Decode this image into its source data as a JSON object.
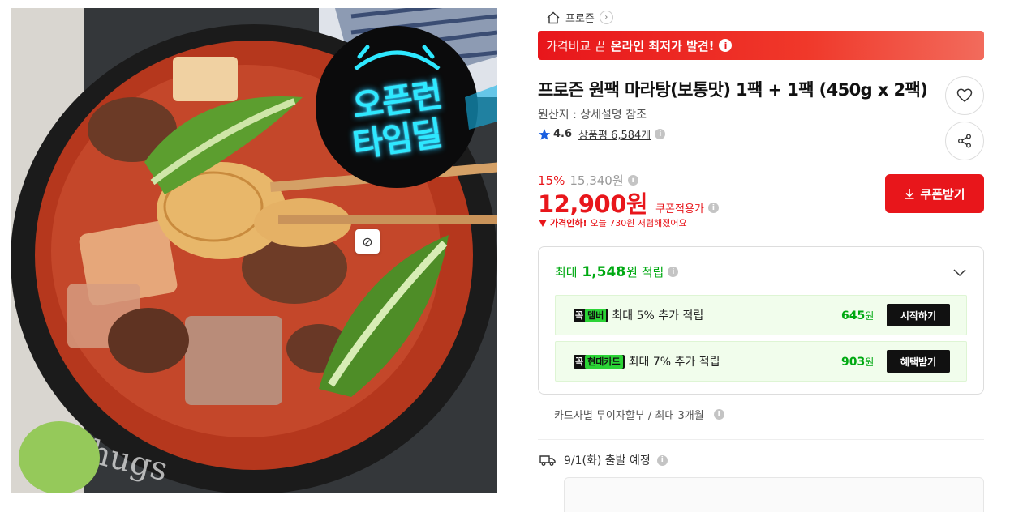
{
  "image": {
    "badge_line1": "오픈런",
    "badge_line2": "타임딜",
    "zoom_icon": "ban-icon"
  },
  "breadcrumb": {
    "home_icon": "home-icon",
    "category": "프로즌",
    "arrow": "›"
  },
  "promo": {
    "prefix": "가격비교 끝",
    "highlight": "온라인 최저가 발견!",
    "info": "i"
  },
  "product": {
    "title": "프로즌 원팩 마라탕(보통맛) 1팩 + 1팩 (450g x 2팩)",
    "origin": "원산지 : 상세설명 참조",
    "rating": "4.6",
    "review_label": "상품평",
    "review_count": "6,584개"
  },
  "price": {
    "discount_rate": "15%",
    "original": "15,340원",
    "final": "12,900원",
    "coupon_applied": "쿠폰적용가",
    "drop_label": "가격인하!",
    "drop_text": "오늘 730원 저렴해졌어요"
  },
  "coupon_button": "쿠폰받기",
  "rewards": {
    "head_prefix": "최대",
    "head_amount": "1,548",
    "head_suffix": "원 적립",
    "rows": [
      {
        "tag_main": "꼭",
        "tag_accent": "멤버",
        "text": "최대 5% 추가 적립",
        "amount": "645",
        "unit": "원",
        "button": "시작하기"
      },
      {
        "tag_main": "꼭",
        "tag_accent": "현대카드",
        "text": "최대 7% 추가 적립",
        "amount": "903",
        "unit": "원",
        "button": "혜택받기"
      }
    ]
  },
  "installment": "카드사별 무이자할부 / 최대 3개월",
  "shipping": "9/1(화) 출발 예정",
  "colors": {
    "accent_red": "#e8161b",
    "reward_green": "#00a912",
    "reward_bg": "#f1fdec"
  }
}
